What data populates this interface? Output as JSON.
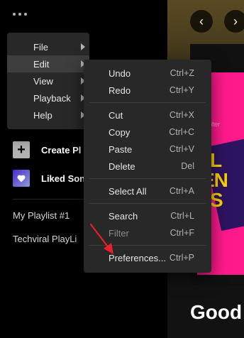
{
  "sidebar": {
    "more_label": "More",
    "create_playlist": "Create Pl",
    "liked_songs": "Liked Son",
    "playlists": [
      "My Playlist #1",
      "Techviral PlayLi"
    ]
  },
  "nav": {
    "back": "‹",
    "forward": "›"
  },
  "cover": {
    "tag": "Filter",
    "line1": "L",
    "line2": "EN",
    "line3": "S"
  },
  "greeting": "Good",
  "main_menu": {
    "items": [
      {
        "label": "File",
        "has_submenu": true
      },
      {
        "label": "Edit",
        "has_submenu": true,
        "active": true
      },
      {
        "label": "View",
        "has_submenu": true
      },
      {
        "label": "Playback",
        "has_submenu": true
      },
      {
        "label": "Help",
        "has_submenu": true
      }
    ]
  },
  "edit_menu": {
    "groups": [
      [
        {
          "label": "Undo",
          "shortcut": "Ctrl+Z"
        },
        {
          "label": "Redo",
          "shortcut": "Ctrl+Y"
        }
      ],
      [
        {
          "label": "Cut",
          "shortcut": "Ctrl+X"
        },
        {
          "label": "Copy",
          "shortcut": "Ctrl+C"
        },
        {
          "label": "Paste",
          "shortcut": "Ctrl+V"
        },
        {
          "label": "Delete",
          "shortcut": "Del"
        }
      ],
      [
        {
          "label": "Select All",
          "shortcut": "Ctrl+A"
        }
      ],
      [
        {
          "label": "Search",
          "shortcut": "Ctrl+L"
        },
        {
          "label": "Filter",
          "shortcut": "Ctrl+F",
          "disabled": true
        }
      ],
      [
        {
          "label": "Preferences...",
          "shortcut": "Ctrl+P"
        }
      ]
    ]
  },
  "colors": {
    "menu_bg": "#282828",
    "accent_pink": "#ff1a8c",
    "accent_yellow": "#ffd400",
    "annotation_red": "#e8202a"
  }
}
